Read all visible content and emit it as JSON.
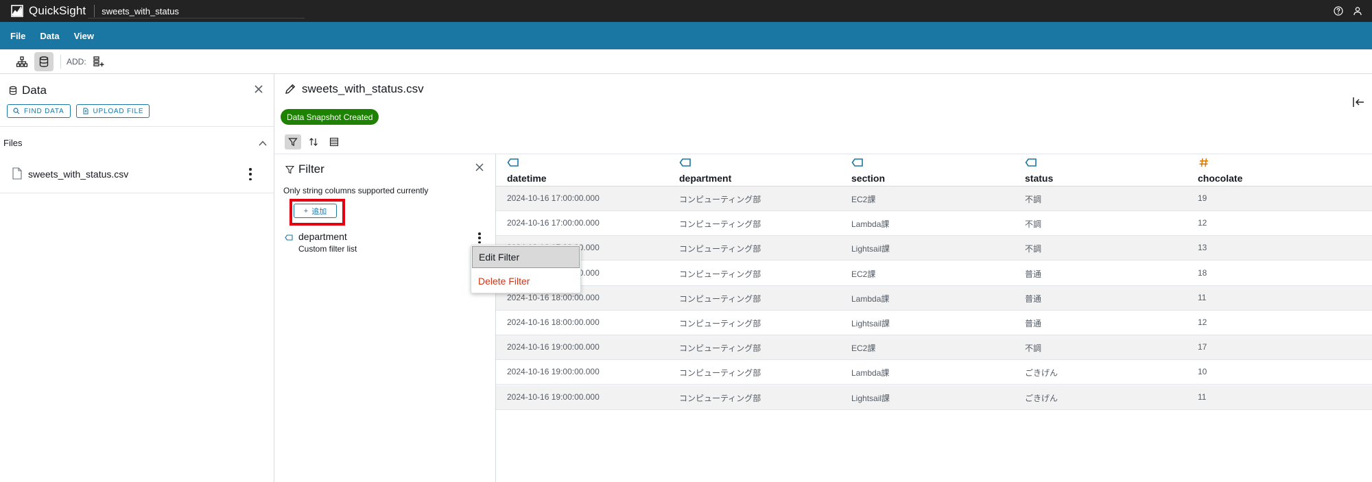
{
  "app": {
    "name": "QuickSight",
    "document_title": "sweets_with_status"
  },
  "menubar": {
    "items": [
      "File",
      "Data",
      "View"
    ]
  },
  "toolbar": {
    "add_label": "ADD:"
  },
  "data_panel": {
    "title": "Data",
    "find_data_label": "FIND DATA",
    "upload_file_label": "UPLOAD FILE",
    "files_label": "Files",
    "files": [
      {
        "name": "sweets_with_status.csv"
      }
    ]
  },
  "editor": {
    "title": "sweets_with_status.csv",
    "snapshot_badge": "Data Snapshot Created"
  },
  "filter_panel": {
    "title": "Filter",
    "note": "Only string columns supported currently",
    "add_button_label": "追加",
    "filter_item": {
      "name": "department",
      "description": "Custom filter list"
    }
  },
  "context_menu": {
    "edit_label": "Edit Filter",
    "delete_label": "Delete Filter"
  },
  "table": {
    "columns": [
      {
        "name": "datetime",
        "type": "string"
      },
      {
        "name": "department",
        "type": "string"
      },
      {
        "name": "section",
        "type": "string"
      },
      {
        "name": "status",
        "type": "string"
      },
      {
        "name": "chocolate",
        "type": "number"
      }
    ],
    "rows": [
      [
        "2024-10-16 17:00:00.000",
        "コンピューティング部",
        "EC2課",
        "不調",
        "19"
      ],
      [
        "2024-10-16 17:00:00.000",
        "コンピューティング部",
        "Lambda課",
        "不調",
        "12"
      ],
      [
        "2024-10-16 17:00:00.000",
        "コンピューティング部",
        "Lightsail課",
        "不調",
        "13"
      ],
      [
        "2024-10-16 18:00:00.000",
        "コンピューティング部",
        "EC2課",
        "普通",
        "18"
      ],
      [
        "2024-10-16 18:00:00.000",
        "コンピューティング部",
        "Lambda課",
        "普通",
        "11"
      ],
      [
        "2024-10-16 18:00:00.000",
        "コンピューティング部",
        "Lightsail課",
        "普通",
        "12"
      ],
      [
        "2024-10-16 19:00:00.000",
        "コンピューティング部",
        "EC2課",
        "不調",
        "17"
      ],
      [
        "2024-10-16 19:00:00.000",
        "コンピューティング部",
        "Lambda課",
        "ごきげん",
        "10"
      ],
      [
        "2024-10-16 19:00:00.000",
        "コンピューティング部",
        "Lightsail課",
        "ごきげん",
        "11"
      ]
    ]
  },
  "colors": {
    "menubar": "#1a76a3",
    "topbar": "#232323",
    "snapshot_badge": "#1d8102",
    "highlight_box": "#e4000f",
    "delete_text": "#d13212",
    "number_type_icon": "#e07b00"
  }
}
